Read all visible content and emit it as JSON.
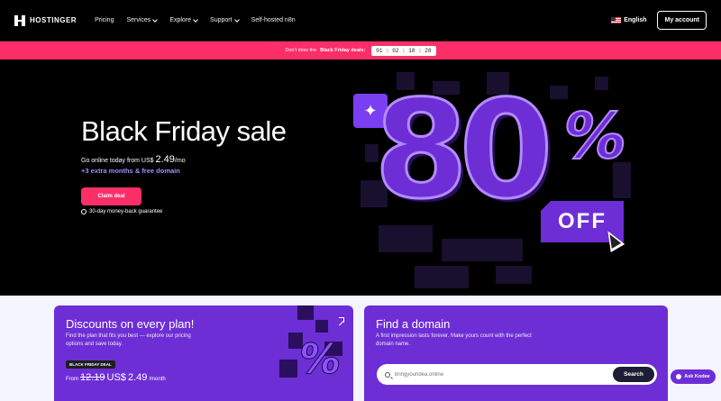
{
  "nav": {
    "logo": "HOSTINGER",
    "items": [
      {
        "label": "Pricing",
        "dropdown": false
      },
      {
        "label": "Services",
        "dropdown": true
      },
      {
        "label": "Explore",
        "dropdown": true
      },
      {
        "label": "Support",
        "dropdown": true
      },
      {
        "label": "Self-hosted n8n",
        "dropdown": false
      }
    ],
    "language": "English",
    "account_button": "My account"
  },
  "promo": {
    "text_before": "Don't miss the",
    "text_bold": "Black Friday deals:",
    "timer": "01 : 02 : 18 : 28"
  },
  "hero": {
    "title": "Black Friday sale",
    "line_prefix": "Go online today from US$",
    "price": "2.49",
    "period": "/mo",
    "bonus": "+3 extra months & free domain",
    "cta": "Claim deal",
    "guarantee": "30-day money-back guarantee",
    "art": {
      "number": "80",
      "percent": "%",
      "off": "OFF",
      "sparkle": "✦"
    }
  },
  "card1": {
    "title": "Discounts on every plan!",
    "description": "Find the plan that fits you best — explore our pricing options and save today.",
    "badge": "BLACK FRIDAY DEAL",
    "from": "From",
    "old_price": "12.19",
    "currency": "US$",
    "new_price": "2.49",
    "period": "/month",
    "art_symbol": "%"
  },
  "card2": {
    "title": "Find a domain",
    "description": "A first impression lasts forever. Make yours count with the perfect domain name.",
    "search_placeholder": "bringyouridea.online",
    "search_button": "Search"
  },
  "kodee": {
    "label": "Ask Kodee"
  },
  "colors": {
    "brand_purple": "#6d2ed6",
    "promo_pink": "#fc2e68",
    "accent_lavender": "#a58bff"
  }
}
